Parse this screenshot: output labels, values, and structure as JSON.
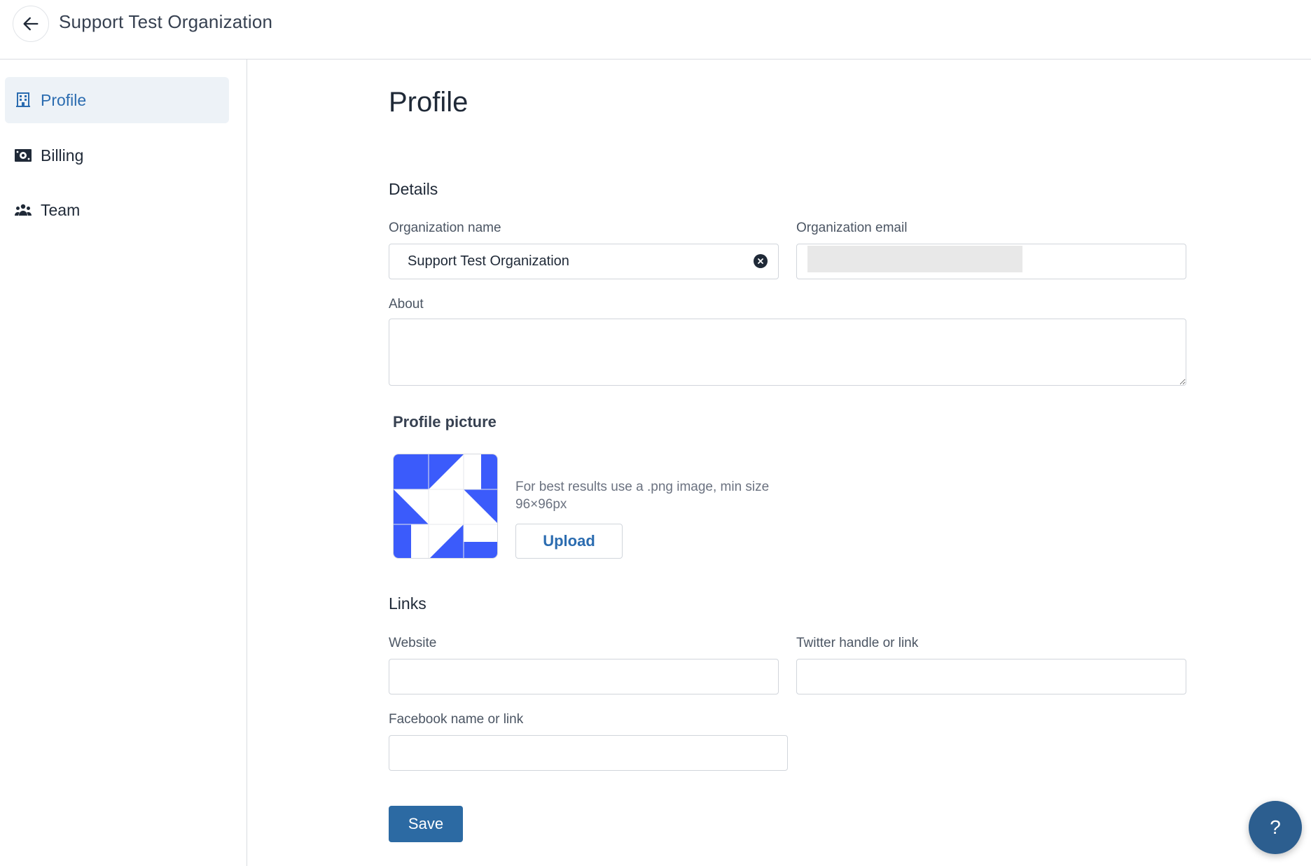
{
  "header": {
    "title": "Support Test Organization"
  },
  "sidebar": {
    "items": [
      {
        "label": "Profile",
        "icon": "building-icon",
        "active": true
      },
      {
        "label": "Billing",
        "icon": "money-icon",
        "active": false
      },
      {
        "label": "Team",
        "icon": "team-icon",
        "active": false
      }
    ]
  },
  "main": {
    "page_title": "Profile",
    "details": {
      "title": "Details",
      "org_name_label": "Organization name",
      "org_name_value": "Support Test Organization",
      "org_email_label": "Organization email",
      "org_email_value": "",
      "about_label": "About",
      "about_value": ""
    },
    "profile_picture": {
      "title": "Profile picture",
      "hint": "For best results use a .png image, min size 96×96px",
      "upload_label": "Upload"
    },
    "links": {
      "title": "Links",
      "website_label": "Website",
      "website_value": "",
      "twitter_label": "Twitter handle or link",
      "twitter_value": "",
      "facebook_label": "Facebook name or link",
      "facebook_value": ""
    },
    "save_label": "Save"
  },
  "help": {
    "label": "?"
  },
  "colors": {
    "accent": "#2b6cb0",
    "primary_button": "#2c6aa3",
    "help_button": "#2c5e8f",
    "avatar_blue": "#3b5bfb",
    "active_nav_bg": "#edf2f7"
  }
}
